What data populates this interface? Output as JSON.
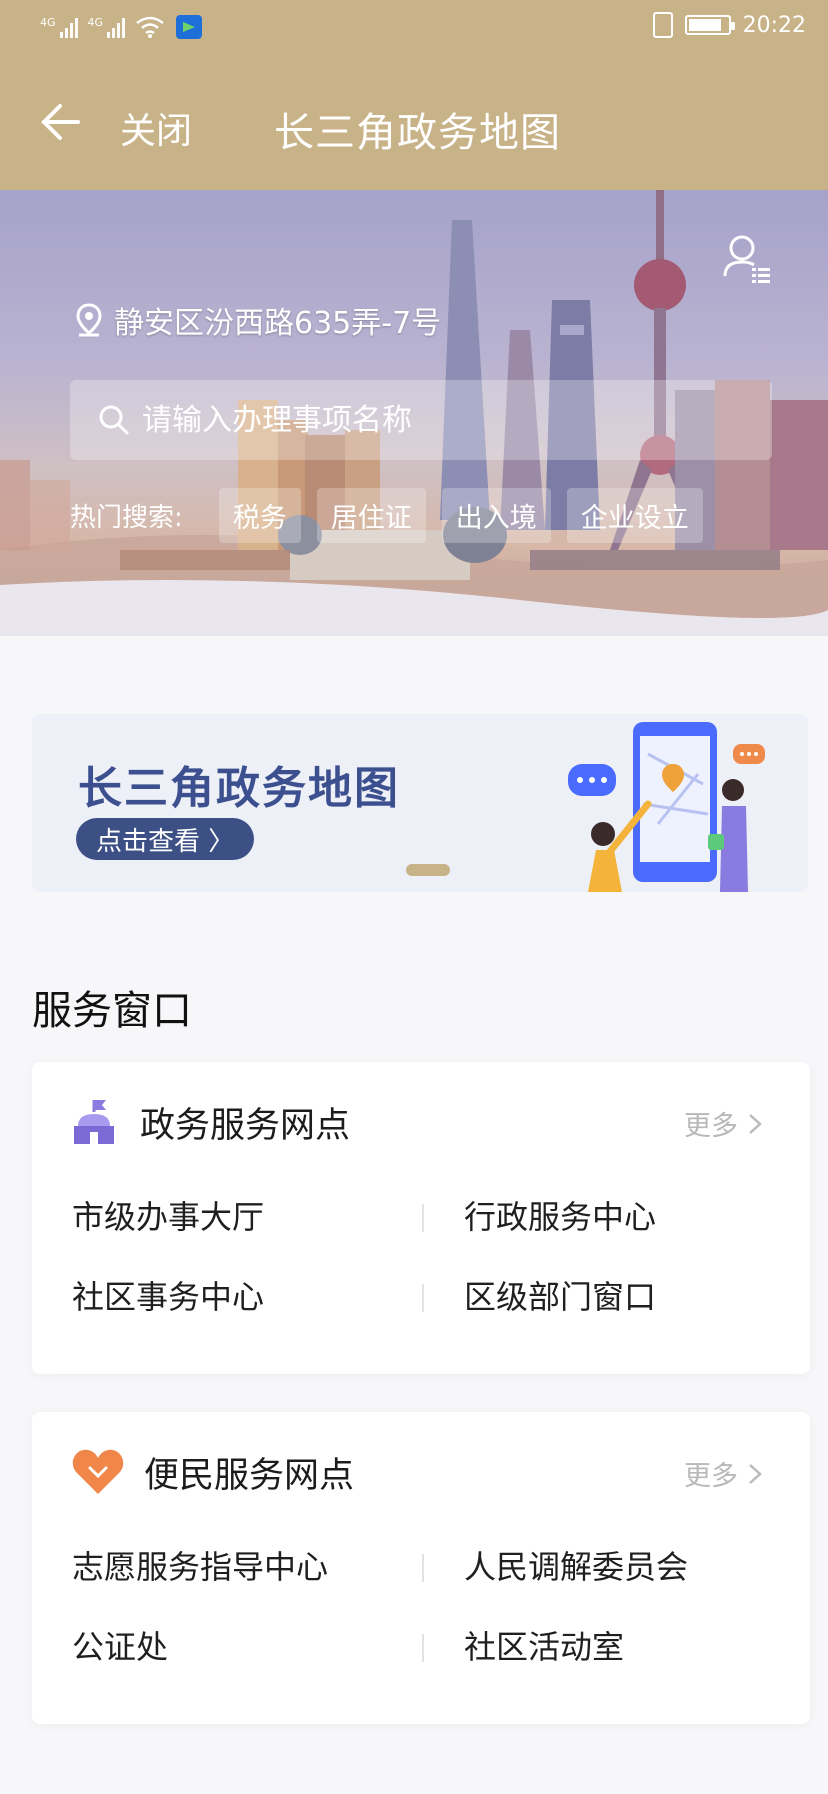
{
  "status_bar": {
    "network_left": "4G",
    "network_right": "4G",
    "time": "20:22",
    "battery_level": 0.85
  },
  "nav": {
    "close_label": "关闭",
    "title": "长三角政务地图"
  },
  "hero": {
    "location": "静安区汾西路635弄-7号",
    "search_placeholder": "请输入办理事项名称",
    "hot_label": "热门搜索:",
    "hot_tags": [
      "税务",
      "居住证",
      "出入境",
      "企业设立"
    ]
  },
  "promo": {
    "title": "长三角政务地图",
    "button_label": "点击查看 〉"
  },
  "section_title": "服务窗口",
  "cards": [
    {
      "title": "政务服务网点",
      "more_label": "更多",
      "items": [
        "市级办事大厅",
        "行政服务中心",
        "社区事务中心",
        "区级部门窗口"
      ]
    },
    {
      "title": "便民服务网点",
      "more_label": "更多",
      "items": [
        "志愿服务指导中心",
        "人民调解委员会",
        "公证处",
        "社区活动室"
      ]
    }
  ],
  "colors": {
    "nav_gold": "#c8b287",
    "promo_blue": "#3c5085",
    "icon_purple": "#8a7be0",
    "icon_orange": "#f0864a"
  }
}
